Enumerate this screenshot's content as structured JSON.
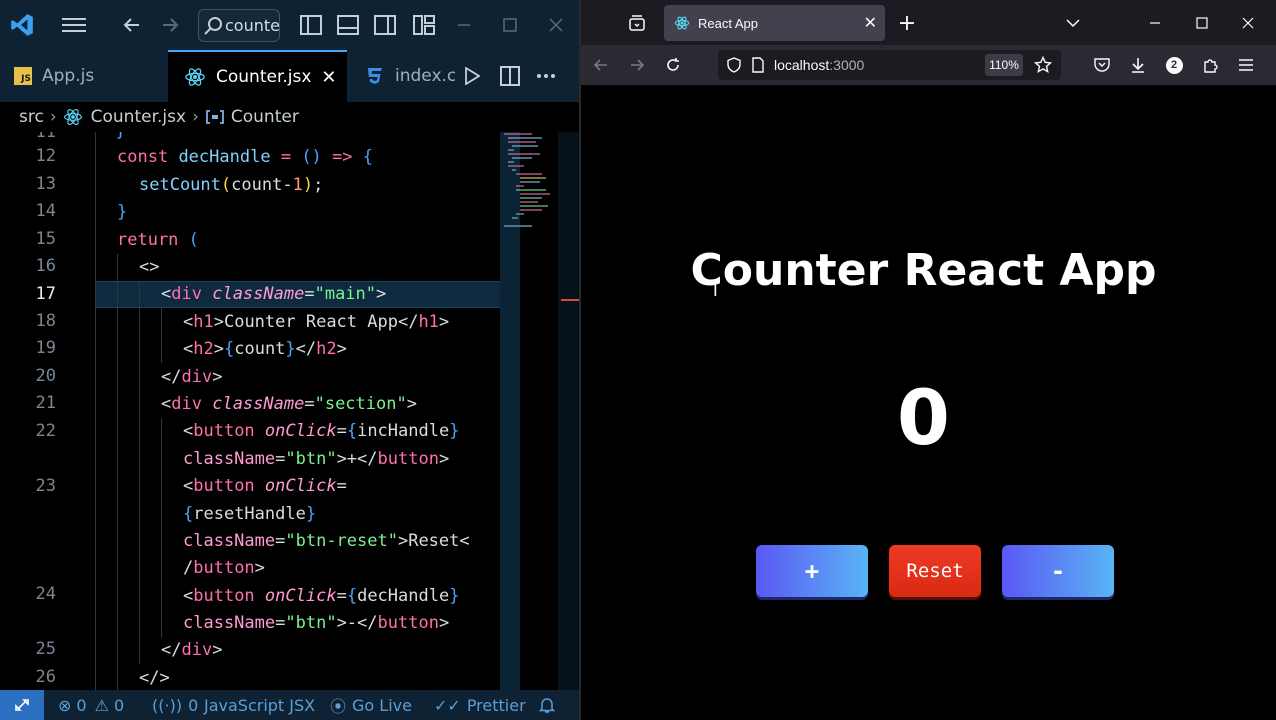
{
  "vscode": {
    "search_text": "counte",
    "tabs": [
      {
        "badge": "JS",
        "label": "App.js",
        "active": false
      },
      {
        "label": "Counter.jsx",
        "active": true
      },
      {
        "badge": "CSS",
        "label": "index.c",
        "active": false
      }
    ],
    "breadcrumb": {
      "folder": "src",
      "file": "Counter.jsx",
      "symbol": "Counter"
    },
    "line_numbers": [
      "11",
      "12",
      "13",
      "14",
      "15",
      "16",
      "17",
      "18",
      "19",
      "20",
      "21",
      "22",
      "",
      "23",
      "",
      "",
      "",
      "24",
      "",
      "25",
      "26"
    ],
    "current_line": "17",
    "status": {
      "errors": "0",
      "warnings": "0",
      "ports": "0",
      "language": "JavaScript JSX",
      "go_live": "Go Live",
      "prettier": "Prettier"
    },
    "colors": {
      "accent": "#2a6fc0",
      "editor_bg": "#000000"
    }
  },
  "browser": {
    "tab_title": "React App",
    "url_host": "localhost",
    "url_port": ":3000",
    "zoom": "110%",
    "notification_count": "2"
  },
  "app": {
    "title": "Counter React App",
    "count": "0",
    "buttons": {
      "increment": "+",
      "reset": "Reset",
      "decrement": "-"
    },
    "colors": {
      "btn_grad_start": "#5a58f4",
      "btn_grad_end": "#59b4f5",
      "reset": "#e5331d"
    }
  }
}
